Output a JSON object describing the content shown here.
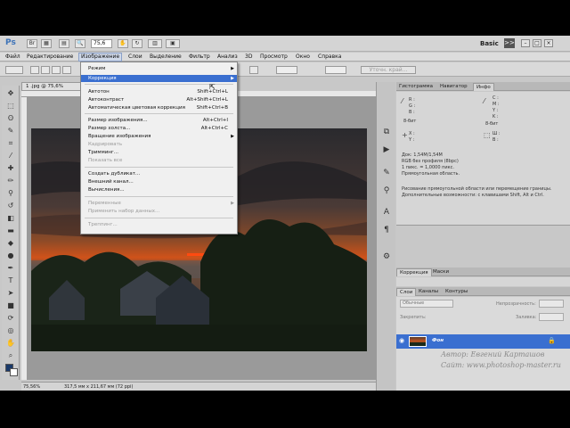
{
  "app": {
    "logo": "Ps",
    "zoom": "75,6",
    "workspace": "Basic",
    "workspace_expand": ">>"
  },
  "menubar": [
    "Файл",
    "Редактирование",
    "Изображение",
    "Слои",
    "Выделение",
    "Фильтр",
    "Анализ",
    "3D",
    "Просмотр",
    "Окно",
    "Справка"
  ],
  "optionsbar": {
    "refine_edge": "Уточн. край..."
  },
  "document": {
    "tab_title": "1 .jpg @ 75,6% (RGB/8)",
    "status_zoom": "75,56%",
    "status_size": "317,5 мм x 211,67 мм (72 ppi)"
  },
  "dropdown": {
    "items": [
      {
        "label": "Режим",
        "shortcut": "",
        "submenu": true,
        "disabled": false,
        "highlight": false
      },
      {
        "label": "Коррекция",
        "shortcut": "",
        "submenu": true,
        "disabled": false,
        "highlight": true
      },
      {
        "label": "Автотон",
        "shortcut": "Shift+Ctrl+L",
        "submenu": false,
        "disabled": false,
        "highlight": false
      },
      {
        "label": "Автоконтраст",
        "shortcut": "Alt+Shift+Ctrl+L",
        "submenu": false,
        "disabled": false,
        "highlight": false
      },
      {
        "label": "Автоматическая цветовая коррекция",
        "shortcut": "Shift+Ctrl+B",
        "submenu": false,
        "disabled": false,
        "highlight": false
      },
      {
        "label": "Размер изображения...",
        "shortcut": "Alt+Ctrl+I",
        "submenu": false,
        "disabled": false,
        "highlight": false
      },
      {
        "label": "Размер холста...",
        "shortcut": "Alt+Ctrl+C",
        "submenu": false,
        "disabled": false,
        "highlight": false
      },
      {
        "label": "Вращение изображения",
        "shortcut": "",
        "submenu": true,
        "disabled": false,
        "highlight": false
      },
      {
        "label": "Кадрировать",
        "shortcut": "",
        "submenu": false,
        "disabled": true,
        "highlight": false
      },
      {
        "label": "Тримминг...",
        "shortcut": "",
        "submenu": false,
        "disabled": false,
        "highlight": false
      },
      {
        "label": "Показать все",
        "shortcut": "",
        "submenu": false,
        "disabled": true,
        "highlight": false
      },
      {
        "label": "Создать дубликат...",
        "shortcut": "",
        "submenu": false,
        "disabled": false,
        "highlight": false
      },
      {
        "label": "Внешний канал...",
        "shortcut": "",
        "submenu": false,
        "disabled": false,
        "highlight": false
      },
      {
        "label": "Вычисления...",
        "shortcut": "",
        "submenu": false,
        "disabled": false,
        "highlight": false
      },
      {
        "label": "Переменные",
        "shortcut": "",
        "submenu": true,
        "disabled": true,
        "highlight": false
      },
      {
        "label": "Применить набор данных...",
        "shortcut": "",
        "submenu": false,
        "disabled": true,
        "highlight": false
      },
      {
        "label": "Треппинг...",
        "shortcut": "",
        "submenu": false,
        "disabled": true,
        "highlight": false
      }
    ]
  },
  "panels": {
    "top_tabs": [
      "Гистограмма",
      "Навигатор",
      "Инфо"
    ],
    "info": {
      "r": "R :",
      "g": "G :",
      "b": "B :",
      "c": "C :",
      "m": "M :",
      "y": "Y :",
      "k": "K :",
      "bit1": "8-бит",
      "bit2": "8-бит",
      "x": "X :",
      "yy": "Y :",
      "w": "Ш :",
      "h": "В :",
      "doc": "Док: 1,54M/1,54M",
      "profile": "RGB без профиля (8bpc)",
      "pixel": "1 пикс. = 1,0000 пикс.",
      "area": "Прямоугольная область.",
      "hint1": "Рисование прямоугольной области или перемещение границы.",
      "hint2": "Дополнительные возможности: с клавишами Shift, Alt и Ctrl."
    },
    "mid_tabs": [
      "Коррекция",
      "Маски"
    ],
    "layer_tabs": [
      "Слои",
      "Каналы",
      "Контуры"
    ],
    "blend_mode": "Обычные",
    "opacity_label": "Непрозрачность:",
    "lock_label": "Закрепить:",
    "fill_label": "Заливка:",
    "layer_name": "Фон"
  },
  "watermark": {
    "line1": "Автор: Евгений Карташов",
    "line2": "Сайт: www.photoshop-master.ru"
  }
}
